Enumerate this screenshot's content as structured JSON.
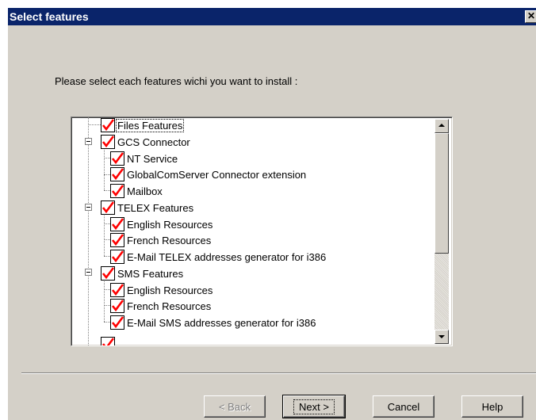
{
  "window": {
    "title": "Select features",
    "close_label": "✕"
  },
  "prompt": "Please select each features wichi you want to install :",
  "tree": {
    "items": [
      {
        "label": "Files Features",
        "checked": true,
        "selected": true
      },
      {
        "label": "GCS Connector",
        "checked": true,
        "expanded": true
      },
      {
        "label": "NT Service",
        "checked": true
      },
      {
        "label": "GlobalComServer Connector extension",
        "checked": true
      },
      {
        "label": "Mailbox",
        "checked": true
      },
      {
        "label": "TELEX Features",
        "checked": true,
        "expanded": true
      },
      {
        "label": "English Resources",
        "checked": true
      },
      {
        "label": "French Resources",
        "checked": true
      },
      {
        "label": "E-Mail TELEX addresses generator for i386",
        "checked": true
      },
      {
        "label": "SMS Features",
        "checked": true,
        "expanded": true
      },
      {
        "label": "English Resources",
        "checked": true
      },
      {
        "label": "French Resources",
        "checked": true
      },
      {
        "label": "E-Mail SMS addresses generator for i386",
        "checked": true
      }
    ]
  },
  "buttons": {
    "back": "< Back",
    "next": "Next >",
    "cancel": "Cancel",
    "help": "Help"
  },
  "colors": {
    "titlebar": "#0a246a",
    "check": "#ff0000",
    "face": "#d4d0c8"
  }
}
